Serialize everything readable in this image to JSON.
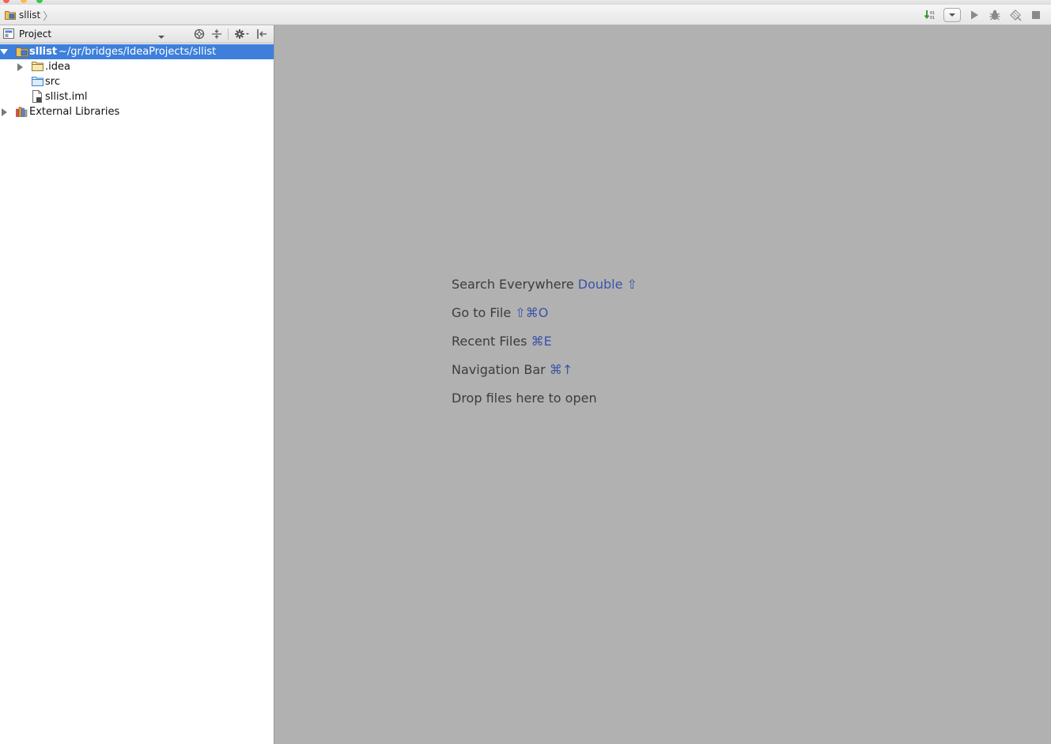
{
  "breadcrumb": {
    "project": "sllist"
  },
  "project_panel": {
    "view_label": "Project",
    "tree": [
      {
        "label": "sllist",
        "path": "~/gr/bridges/IdeaProjects/sllist",
        "selected": true,
        "expanded": true
      },
      {
        "label": ".idea",
        "expanded": false
      },
      {
        "label": "src"
      },
      {
        "label": "sllist.iml"
      },
      {
        "label": "External Libraries",
        "expanded": false
      }
    ]
  },
  "editor": {
    "hints": [
      {
        "text": "Search Everywhere",
        "shortcut": "Double ⇧"
      },
      {
        "text": "Go to File",
        "shortcut": "⇧⌘O"
      },
      {
        "text": "Recent Files",
        "shortcut": "⌘E"
      },
      {
        "text": "Navigation Bar",
        "shortcut": "⌘↑"
      },
      {
        "text": "Drop files here to open",
        "shortcut": ""
      }
    ]
  },
  "colors": {
    "selection": "#3d7fdb",
    "editor_bg": "#b1b1b1",
    "shortcut": "#3a54a8"
  }
}
